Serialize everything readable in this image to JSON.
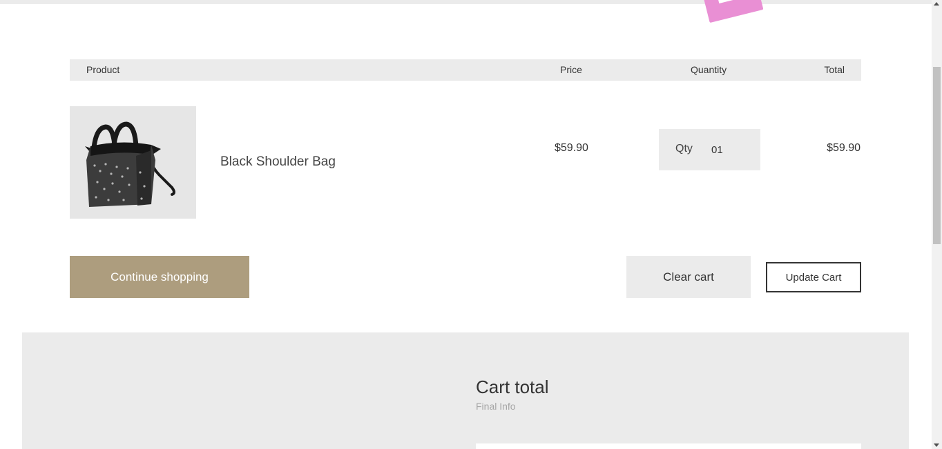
{
  "table_header": {
    "product": "Product",
    "price": "Price",
    "quantity": "Quantity",
    "total": "Total"
  },
  "cart_items": [
    {
      "image_icon": "handbag-icon",
      "name": "Black Shoulder Bag",
      "price": "$59.90",
      "qty_label": "Qty",
      "qty_value": "01",
      "total": "$59.90"
    }
  ],
  "actions": {
    "continue_label": "Continue shopping",
    "clear_label": "Clear cart",
    "update_label": "Update Cart"
  },
  "cart_total": {
    "title": "Cart total",
    "subtitle": "Final Info"
  },
  "colors": {
    "accent": "#ad9d7e",
    "panel": "#ebebeb",
    "text": "#333333",
    "promo_tag": "#e98fd4"
  }
}
